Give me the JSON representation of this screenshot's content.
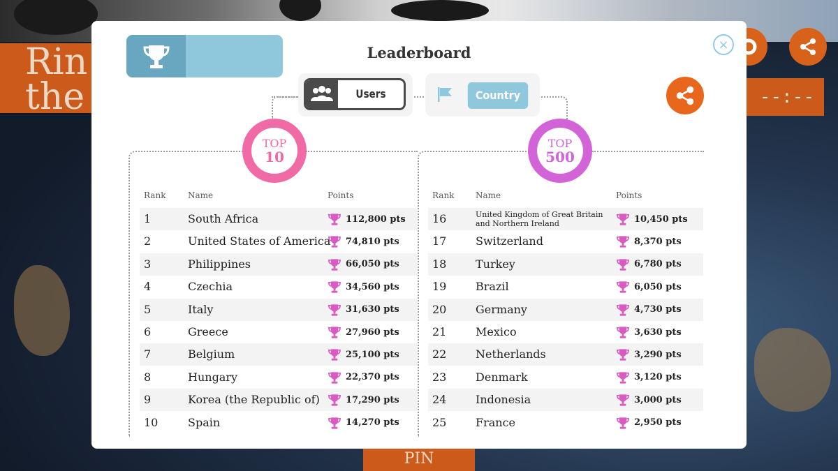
{
  "background": {
    "title_text": "Rin\nthe",
    "timer_text": "--:--",
    "pin_label": "PIN",
    "colors": {
      "orange": "#cc5b1b",
      "ocean": "#24364f"
    }
  },
  "modal": {
    "title": "Leaderboard",
    "close_icon": "×",
    "mode_tab_icon": "trophy-icon",
    "share_icon": "share-icon"
  },
  "toggle": {
    "users_label": "Users",
    "country_label": "Country",
    "active": "Country"
  },
  "badges": {
    "left": {
      "top": "TOP",
      "num": "10",
      "color": "#f06aa5"
    },
    "right": {
      "top": "TOP",
      "num": "500",
      "color": "#d264d8"
    }
  },
  "headers": {
    "rank": "Rank",
    "name": "Name",
    "points": "Points"
  },
  "leaderboard_left": [
    {
      "rank": "1",
      "name": "South Africa",
      "points": "112,800 pts"
    },
    {
      "rank": "2",
      "name": "United States of America",
      "points": "74,810 pts"
    },
    {
      "rank": "3",
      "name": "Philippines",
      "points": "66,050 pts"
    },
    {
      "rank": "4",
      "name": "Czechia",
      "points": "34,560 pts"
    },
    {
      "rank": "5",
      "name": "Italy",
      "points": "31,630 pts"
    },
    {
      "rank": "6",
      "name": "Greece",
      "points": "27,960 pts"
    },
    {
      "rank": "7",
      "name": "Belgium",
      "points": "25,100 pts"
    },
    {
      "rank": "8",
      "name": "Hungary",
      "points": "22,370 pts"
    },
    {
      "rank": "9",
      "name": "Korea (the Republic of)",
      "points": "17,290 pts"
    },
    {
      "rank": "10",
      "name": "Spain",
      "points": "14,270 pts"
    }
  ],
  "leaderboard_right": [
    {
      "rank": "16",
      "name": "United Kingdom of Great Britain and Northern Ireland",
      "points": "10,450 pts"
    },
    {
      "rank": "17",
      "name": "Switzerland",
      "points": "8,370 pts"
    },
    {
      "rank": "18",
      "name": "Turkey",
      "points": "6,780 pts"
    },
    {
      "rank": "19",
      "name": "Brazil",
      "points": "6,050 pts"
    },
    {
      "rank": "20",
      "name": "Germany",
      "points": "4,730 pts"
    },
    {
      "rank": "21",
      "name": "Mexico",
      "points": "3,630 pts"
    },
    {
      "rank": "22",
      "name": "Netherlands",
      "points": "3,290 pts"
    },
    {
      "rank": "23",
      "name": "Denmark",
      "points": "3,120 pts"
    },
    {
      "rank": "24",
      "name": "Indonesia",
      "points": "3,000 pts"
    },
    {
      "rank": "25",
      "name": "France",
      "points": "2,950 pts"
    }
  ],
  "trophy_color": "#d95bc2"
}
